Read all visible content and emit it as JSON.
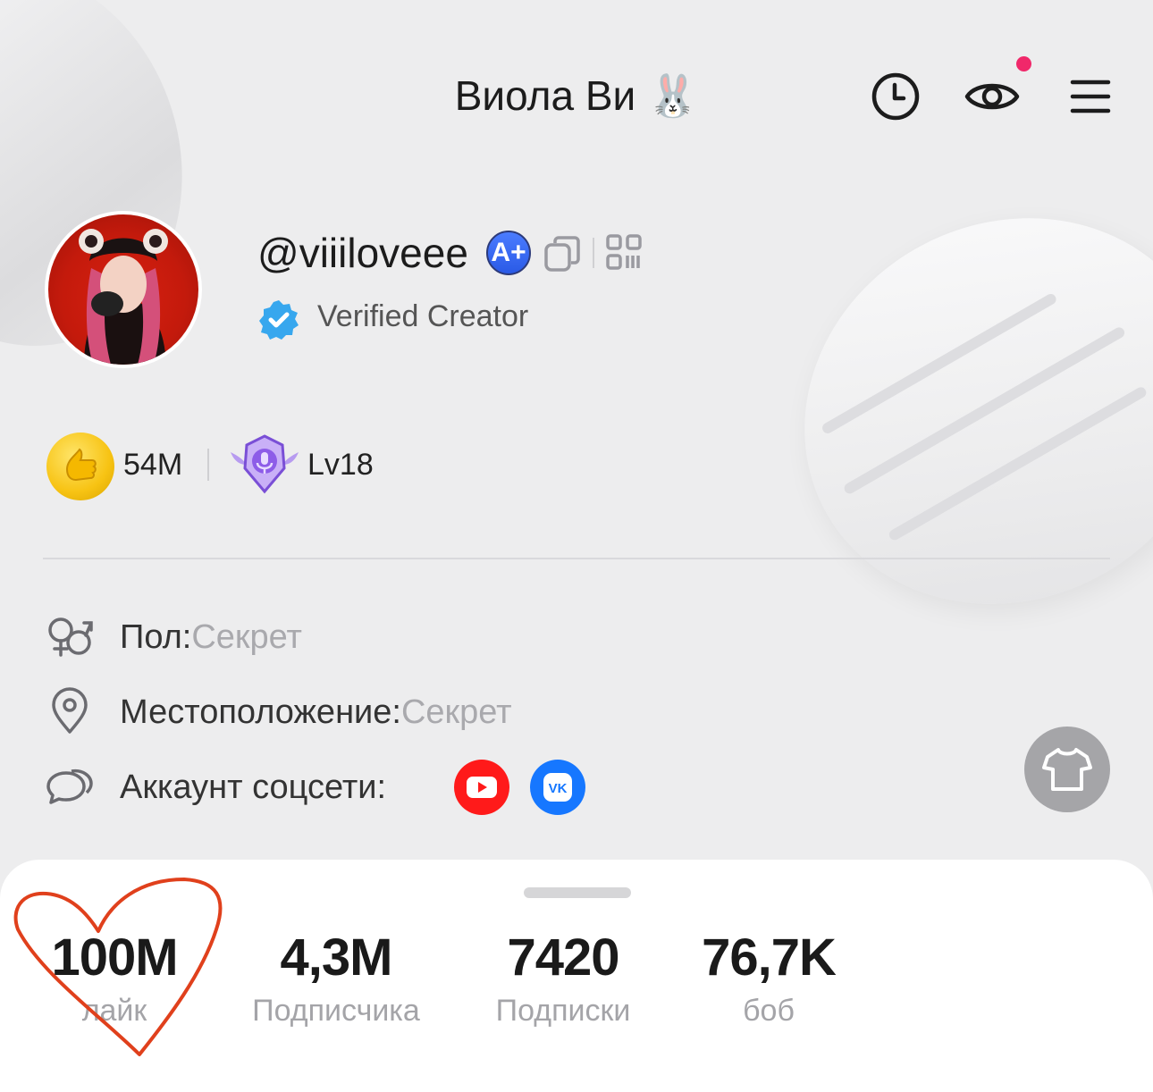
{
  "header": {
    "title": "Виола Ви 🐰",
    "icons": [
      "history-icon",
      "visitors-eye-icon",
      "menu-icon"
    ],
    "notification_dot_color": "#f0286a"
  },
  "profile": {
    "username": "@viiiloveee",
    "badge": "A+",
    "verified_text": "Verified Creator"
  },
  "stats_row": {
    "coins": "54M",
    "level": "Lv18"
  },
  "info": {
    "gender_label": "Пол:",
    "gender_value": "Секрет",
    "location_label": "Местоположение:",
    "location_value": "Секрет",
    "social_label": "Аккаунт соцсети:",
    "social_links": [
      "youtube-icon",
      "vk-icon"
    ]
  },
  "counters": [
    {
      "value": "100M",
      "caption": "лайк"
    },
    {
      "value": "4,3M",
      "caption": "Подписчика"
    },
    {
      "value": "7420",
      "caption": "Подписки"
    },
    {
      "value": "76,7K",
      "caption": "боб"
    }
  ],
  "colors": {
    "background": "#ededee",
    "youtube": "#ff1a1a",
    "vk": "#1677ff",
    "heart_scribble": "#e0401c"
  }
}
